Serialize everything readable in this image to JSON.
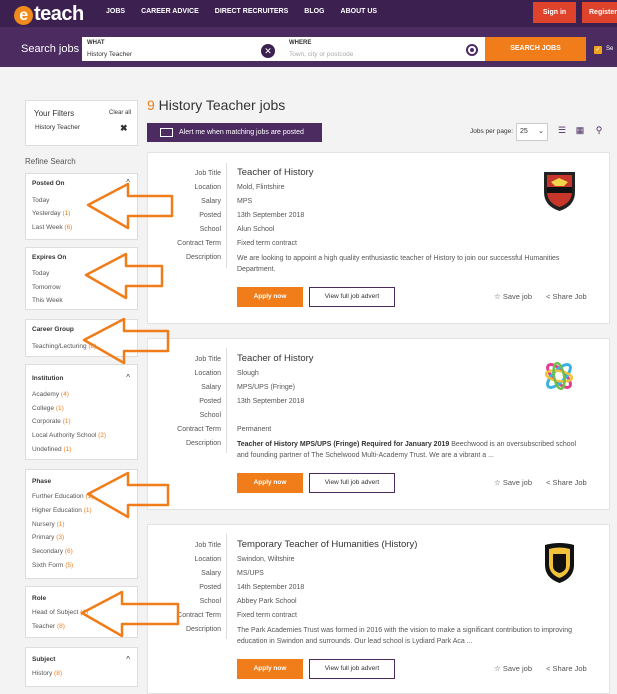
{
  "nav": {
    "logo": "teach",
    "logo_e": "e",
    "links": [
      "JOBS",
      "CAREER ADVICE",
      "DIRECT RECRUITERS",
      "BLOG",
      "ABOUT US"
    ],
    "signin": "Sign in",
    "register": "Register"
  },
  "search": {
    "label": "Search jobs",
    "what_label": "WHAT",
    "what_value": "History Teacher",
    "where_label": "WHERE",
    "where_placeholder": "Town, city or postcode",
    "button": "SEARCH JOBS",
    "check_label": "Se"
  },
  "filters": {
    "title": "Your Filters",
    "clear": "Clear all",
    "tag": "History Teacher",
    "refine": "Refine Search"
  },
  "filter_groups": {
    "posted": {
      "title": "Posted On",
      "items": [
        {
          "label": "Today",
          "n": ""
        },
        {
          "label": "Yesterday",
          "n": "(1)"
        },
        {
          "label": "Last Week",
          "n": "(6)"
        }
      ]
    },
    "expires": {
      "title": "Expires On",
      "items": [
        {
          "label": "Today",
          "n": ""
        },
        {
          "label": "Tomorrow",
          "n": ""
        },
        {
          "label": "This Week",
          "n": ""
        }
      ]
    },
    "career": {
      "title": "Career Group",
      "items": [
        {
          "label": "Teaching/Lecturing",
          "n": "(8)"
        }
      ]
    },
    "institution": {
      "title": "Institution",
      "items": [
        {
          "label": "Academy",
          "n": "(4)"
        },
        {
          "label": "College",
          "n": "(1)"
        },
        {
          "label": "Corporate",
          "n": "(1)"
        },
        {
          "label": "Local Authority School",
          "n": "(2)"
        },
        {
          "label": "Undefined",
          "n": "(1)"
        }
      ]
    },
    "phase": {
      "title": "Phase",
      "items": [
        {
          "label": "Further Education",
          "n": "(1)"
        },
        {
          "label": "Higher Education",
          "n": "(1)"
        },
        {
          "label": "Nursery",
          "n": "(1)"
        },
        {
          "label": "Primary",
          "n": "(3)"
        },
        {
          "label": "Secondary",
          "n": "(6)"
        },
        {
          "label": "Sixth Form",
          "n": "(5)"
        }
      ]
    },
    "role": {
      "title": "Role",
      "items": [
        {
          "label": "Head of Subject",
          "n": "(1)"
        },
        {
          "label": "Teacher",
          "n": "(8)"
        }
      ]
    },
    "subject": {
      "title": "Subject",
      "items": [
        {
          "label": "History",
          "n": "(8)"
        }
      ]
    }
  },
  "results": {
    "count": "9",
    "heading": " History Teacher jobs",
    "alert": "Alert me when matching jobs are posted",
    "per_page_label": "Jobs per page:",
    "per_page_value": "25"
  },
  "field_labels": [
    "Job Title",
    "Location",
    "Salary",
    "Posted",
    "School",
    "Contract Term",
    "Description"
  ],
  "jobs": [
    {
      "title": "Teacher of History",
      "location": "Mold, Flintshire",
      "salary": "MPS",
      "posted": "13th September 2018",
      "school": "Alun School",
      "contract": "Fixed term contract",
      "desc_bold": "",
      "desc": "We are looking to appoint a high quality enthusiastic teacher of History to join our successful Humanities Department."
    },
    {
      "title": "Teacher of History",
      "location": "Slough",
      "salary": "MPS/UPS (Fringe)",
      "posted": "13th September 2018",
      "school": "",
      "contract": "Permanent",
      "desc_bold": "Teacher of History MPS/UPS (Fringe) Required for January 2019",
      "desc": "  Beechwood is an oversubscribed school and founding partner of The Schelwood  Multi-Academy Trust.  We are a vibrant a ..."
    },
    {
      "title": "Temporary Teacher of Humanities (History)",
      "location": "Swindon, Wiltshire",
      "salary": "MS/UPS",
      "posted": "14th September 2018",
      "school": "Abbey Park School",
      "contract": "Fixed term contract",
      "desc_bold": "",
      "desc": "The Park Academies Trust was formed in 2016 with the vision to make a significant contribution to improving education in Swindon and surrounds. Our lead school is Lydiard Park Aca ..."
    }
  ],
  "actions": {
    "apply": "Apply now",
    "full": "View full job advert",
    "save": "Save job",
    "share": "Share Job"
  },
  "colors": {
    "brand": "#3c2150",
    "accent": "#f07d1a",
    "signin": "#e0432b",
    "arrow": "#f07d1a"
  }
}
